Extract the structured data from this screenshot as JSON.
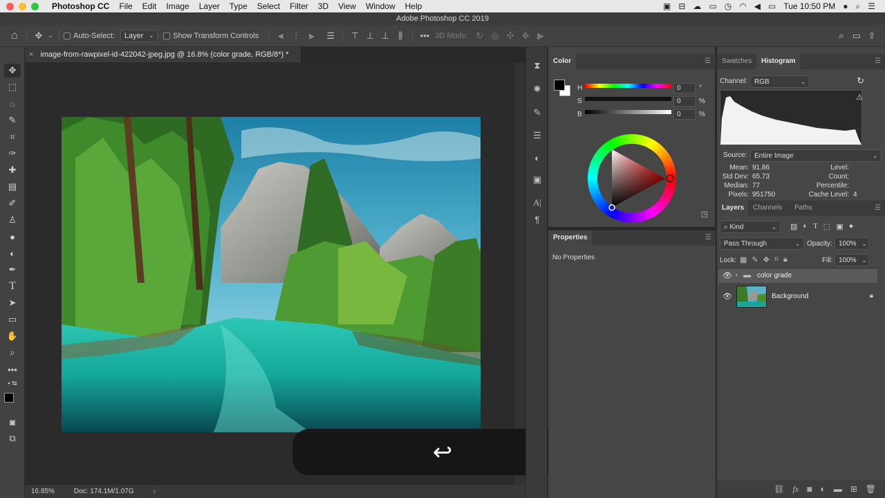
{
  "menubar": {
    "app": "Photoshop CC",
    "items": [
      "File",
      "Edit",
      "Image",
      "Layer",
      "Type",
      "Select",
      "Filter",
      "3D",
      "View",
      "Window",
      "Help"
    ],
    "clock": "Tue 10:50 PM"
  },
  "window": {
    "title": "Adobe Photoshop CC 2019"
  },
  "options": {
    "auto_select_label": "Auto-Select:",
    "auto_select_target": "Layer",
    "show_transform_label": "Show Transform Controls",
    "mode_3d_label": "3D Mode:"
  },
  "document": {
    "tab_title": "image-from-rawpixel-id-422042-jpeg.jpg @ 16.8% (color grade, RGB/8*) *",
    "zoom": "16.85%",
    "doc_size": "Doc: 174.1M/1.07G"
  },
  "color_panel": {
    "title": "Color",
    "h_label": "H",
    "s_label": "S",
    "b_label": "B",
    "h_value": "0",
    "s_value": "0",
    "b_value": "0",
    "h_unit": "°",
    "s_unit": "%",
    "b_unit": "%"
  },
  "properties_panel": {
    "title": "Properties",
    "empty_text": "No Properties"
  },
  "histogram_panel": {
    "tabs": [
      "Swatches",
      "Histogram"
    ],
    "channel_label": "Channel:",
    "channel_value": "RGB",
    "source_label": "Source:",
    "source_value": "Entire Image",
    "stats_left": [
      {
        "label": "Mean:",
        "value": "91.86"
      },
      {
        "label": "Std Dev:",
        "value": "65.73"
      },
      {
        "label": "Median:",
        "value": "77"
      },
      {
        "label": "Pixels:",
        "value": "951750"
      }
    ],
    "stats_right": [
      {
        "label": "Level:",
        "value": ""
      },
      {
        "label": "Count:",
        "value": ""
      },
      {
        "label": "Percentile:",
        "value": ""
      },
      {
        "label": "Cache Level:",
        "value": "4"
      }
    ]
  },
  "layers_panel": {
    "tabs": [
      "Layers",
      "Channels",
      "Paths"
    ],
    "filter_label": "Kind",
    "blend_mode": "Pass Through",
    "opacity_label": "Opacity:",
    "opacity_value": "100%",
    "lock_label": "Lock:",
    "fill_label": "Fill:",
    "fill_value": "100%",
    "layers": [
      {
        "name": "color grade"
      },
      {
        "name": "Background"
      }
    ]
  },
  "colors": {
    "accent_red": "#e03a3a",
    "panel_bg": "#464646",
    "canvas_bg": "#282828"
  }
}
